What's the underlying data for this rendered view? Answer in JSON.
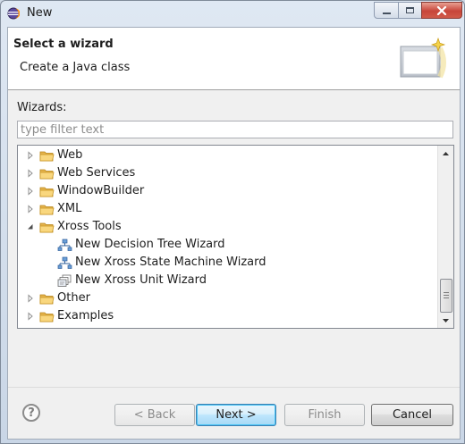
{
  "window": {
    "title": "New",
    "app_icon": "eclipse-icon"
  },
  "header": {
    "title": "Select a wizard",
    "description": "Create a Java class",
    "image": "new-wizard-banner-icon"
  },
  "wizards_label": "Wizards:",
  "filter": {
    "placeholder": "type filter text",
    "value": ""
  },
  "tree": {
    "items": [
      {
        "label": "Web",
        "kind": "folder",
        "expanded": false,
        "level": 0
      },
      {
        "label": "Web Services",
        "kind": "folder",
        "expanded": false,
        "level": 0
      },
      {
        "label": "WindowBuilder",
        "kind": "folder",
        "expanded": false,
        "level": 0
      },
      {
        "label": "XML",
        "kind": "folder",
        "expanded": false,
        "level": 0
      },
      {
        "label": "Xross Tools",
        "kind": "folder",
        "expanded": true,
        "level": 0
      },
      {
        "label": "New Decision Tree Wizard",
        "kind": "wizard-tree",
        "level": 1
      },
      {
        "label": "New Xross State Machine Wizard",
        "kind": "wizard-tree",
        "level": 1
      },
      {
        "label": "New Xross Unit Wizard",
        "kind": "wizard-unit",
        "level": 1
      },
      {
        "label": "Other",
        "kind": "folder",
        "expanded": false,
        "level": 0
      },
      {
        "label": "Examples",
        "kind": "folder",
        "expanded": false,
        "level": 0
      }
    ]
  },
  "buttons": {
    "back": "< Back",
    "next": "Next >",
    "finish": "Finish",
    "cancel": "Cancel"
  },
  "help_glyph": "?"
}
